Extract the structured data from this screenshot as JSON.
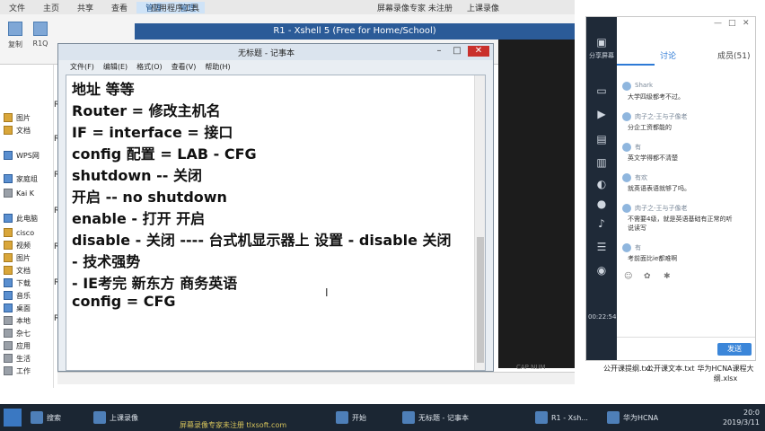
{
  "explorer": {
    "tabs": [
      "主页",
      "共享",
      "查看",
      "管理",
      "管理"
    ],
    "ctx_tab_1": "应用程序工具",
    "ctx_tab_2": "上课录像",
    "title_watermark": "屏幕录像专家 未注册",
    "ribbon_buttons": [
      "复制",
      "R1Q"
    ],
    "nav_items": [
      "图片",
      "文档",
      "WPS网",
      "家庭组",
      "Kai K",
      "此电脑",
      "cisco",
      "视频",
      "图片",
      "文档",
      "下载",
      "音乐",
      "桌面",
      "本地",
      "杂七",
      "应用",
      "生活",
      "工作"
    ]
  },
  "xshell": {
    "title": "R1 - Xshell 5 (Free for Home/School)",
    "session_label": "R1",
    "caps_num": "CAP NUM"
  },
  "notepad": {
    "title": "无标题 - 记事本",
    "menu": [
      "文件(F)",
      "编辑(E)",
      "格式(O)",
      "查看(V)",
      "帮助(H)"
    ],
    "lines": [
      "地址 等等",
      "Router  = 修改主机名",
      "IF = interface = 接口",
      "config 配置 = LAB - CFG",
      "shutdown -- 关闭",
      "开启  -- no shutdown",
      "enable - 打开 开启",
      "disable - 关闭 ---- 台式机显示器上 设置 - disable 关闭",
      "- 技术强势",
      "- IE考完 新东方 商务英语",
      "config = CFG"
    ]
  },
  "chat": {
    "share_label": "分享屏幕",
    "tab_discuss": "讨论",
    "tab_members": "成员(51)",
    "messages": [
      {
        "name": "Shark",
        "text": "大学四级都考不过。"
      },
      {
        "name": "肉子之-王与子像老",
        "text": "分企工资都能的"
      },
      {
        "name": "有",
        "text": "英文学得都不清楚"
      },
      {
        "name": "有欢",
        "text": "就英语表语就够了吗。"
      },
      {
        "name": "肉子之-王与子像老",
        "text": "不需要4级，就是英语基础有正常的听"
      },
      {
        "name": "有",
        "text": "考前面比ie都难啊"
      }
    ],
    "extra_line": "说读写",
    "time": "00:22:54",
    "send_label": "发送",
    "accent": "#2d7ad6"
  },
  "desktop_files": [
    "公开课提纲.txt",
    "公开课文本.txt",
    "华为HCNA课程大纲.xlsx"
  ],
  "taskbar": {
    "items": [
      "搜索",
      "上课录像",
      "开始",
      "无标题 - 记事本",
      "R1 - Xsh...",
      "华为HCNA"
    ],
    "watermark": "屏幕录像专家未注册 tlxsoft.com",
    "time": "20:0",
    "date": "2019/3/11"
  }
}
